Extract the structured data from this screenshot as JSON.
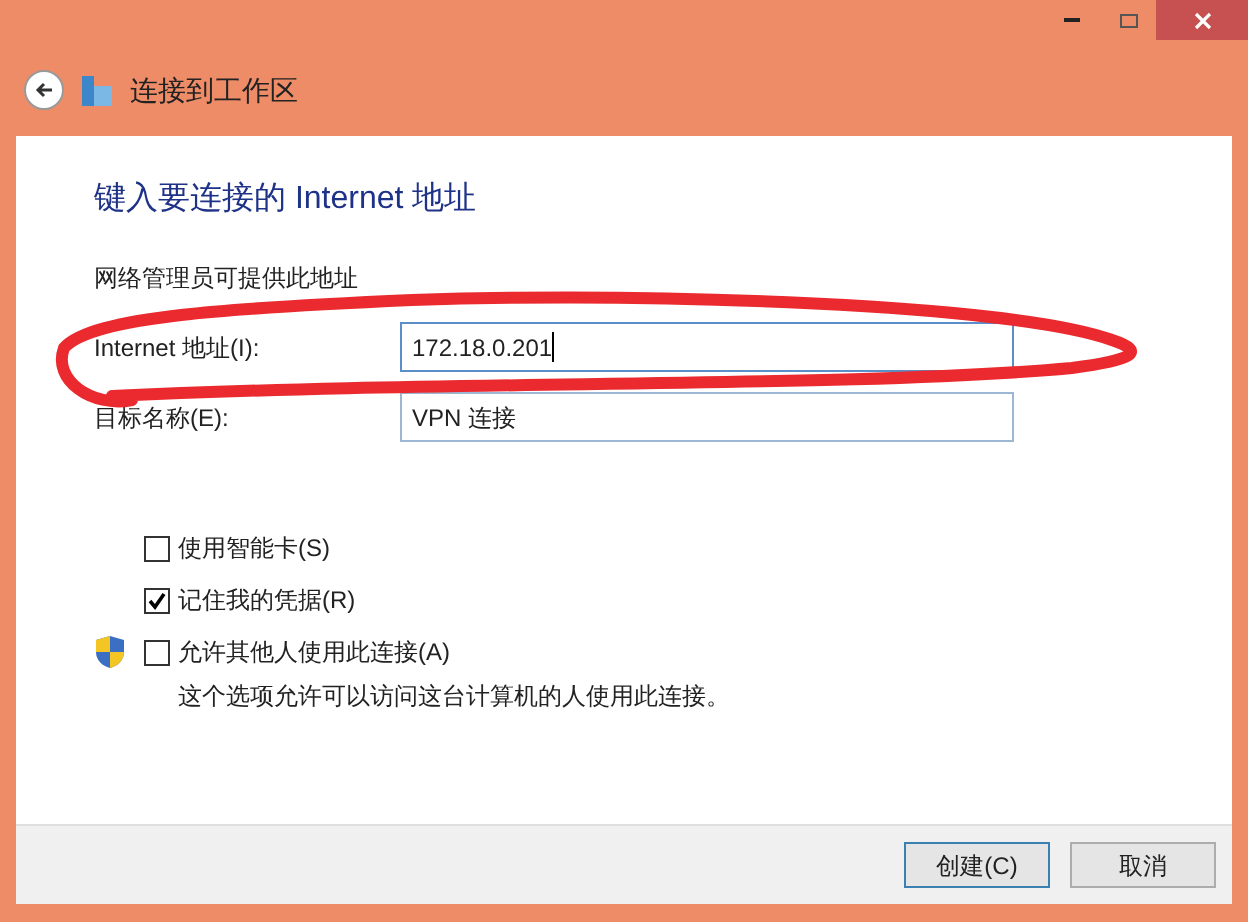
{
  "window": {
    "title": "连接到工作区"
  },
  "heading": "键入要连接的 Internet 地址",
  "hint": "网络管理员可提供此地址",
  "fields": [
    {
      "label": "Internet 地址(I):",
      "value": "172.18.0.201",
      "focused": true
    },
    {
      "label": "目标名称(E):",
      "value": "VPN 连接",
      "focused": false
    }
  ],
  "options": [
    {
      "label": "使用智能卡(S)",
      "checked": false,
      "shield": false
    },
    {
      "label": "记住我的凭据(R)",
      "checked": true,
      "shield": false
    },
    {
      "label": "允许其他人使用此连接(A)",
      "checked": false,
      "shield": true,
      "description": "这个选项允许可以访问这台计算机的人使用此连接。"
    }
  ],
  "buttons": [
    {
      "label": "创建(C)",
      "default": true
    },
    {
      "label": "取消",
      "default": false
    }
  ]
}
